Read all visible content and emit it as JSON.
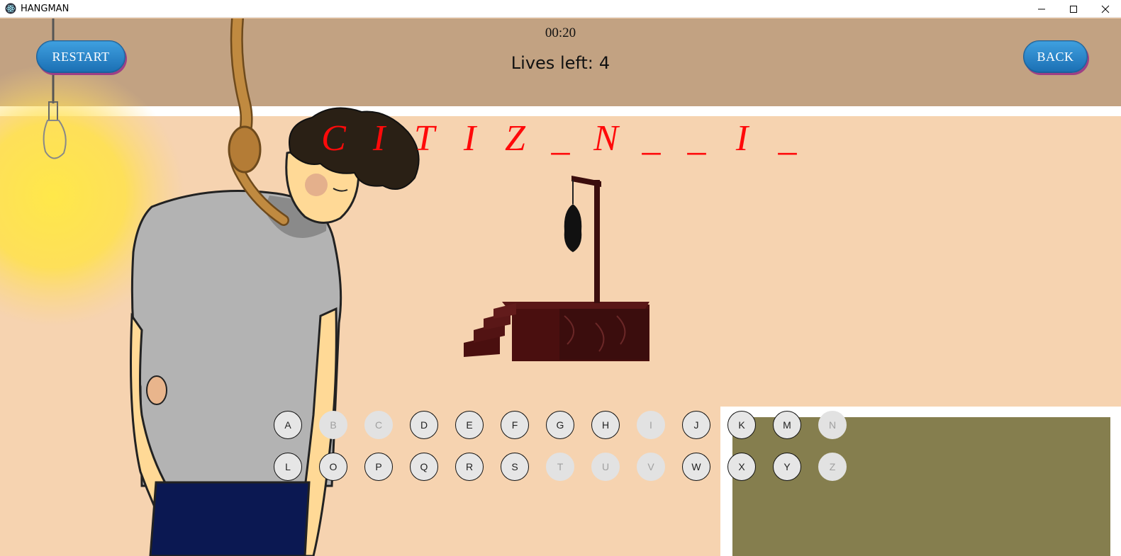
{
  "window": {
    "title": "HANGMAN"
  },
  "hud": {
    "timer": "00:20",
    "lives_label": "Lives left:",
    "lives_value": "4"
  },
  "buttons": {
    "restart": "RESTART",
    "back": "BACK"
  },
  "word_slots": [
    "C",
    "I",
    "T",
    "I",
    "Z",
    "_",
    "N",
    "_",
    "_",
    "I",
    "_"
  ],
  "keyboard": {
    "rows": [
      [
        {
          "letter": "A",
          "used": false
        },
        {
          "letter": "B",
          "used": true
        },
        {
          "letter": "C",
          "used": true
        },
        {
          "letter": "D",
          "used": false
        },
        {
          "letter": "E",
          "used": false
        },
        {
          "letter": "F",
          "used": false
        },
        {
          "letter": "G",
          "used": false
        },
        {
          "letter": "H",
          "used": false
        },
        {
          "letter": "I",
          "used": true
        },
        {
          "letter": "J",
          "used": false
        },
        {
          "letter": "K",
          "used": false
        },
        {
          "letter": "M",
          "used": false
        },
        {
          "letter": "N",
          "used": true
        }
      ],
      [
        {
          "letter": "L",
          "used": false
        },
        {
          "letter": "O",
          "used": false
        },
        {
          "letter": "P",
          "used": false
        },
        {
          "letter": "Q",
          "used": false
        },
        {
          "letter": "R",
          "used": false
        },
        {
          "letter": "S",
          "used": false
        },
        {
          "letter": "T",
          "used": true
        },
        {
          "letter": "U",
          "used": true
        },
        {
          "letter": "V",
          "used": true
        },
        {
          "letter": "W",
          "used": false
        },
        {
          "letter": "X",
          "used": false
        },
        {
          "letter": "Y",
          "used": false
        },
        {
          "letter": "Z",
          "used": true
        }
      ]
    ]
  },
  "icons": {
    "app": "electron-icon",
    "minimize": "minimize-icon",
    "maximize": "maximize-icon",
    "close": "close-icon"
  },
  "colors": {
    "word": "#ff0a0a",
    "button": "#2a8ad0",
    "background": "#f6d3b0",
    "top_band": "#c2a282"
  }
}
